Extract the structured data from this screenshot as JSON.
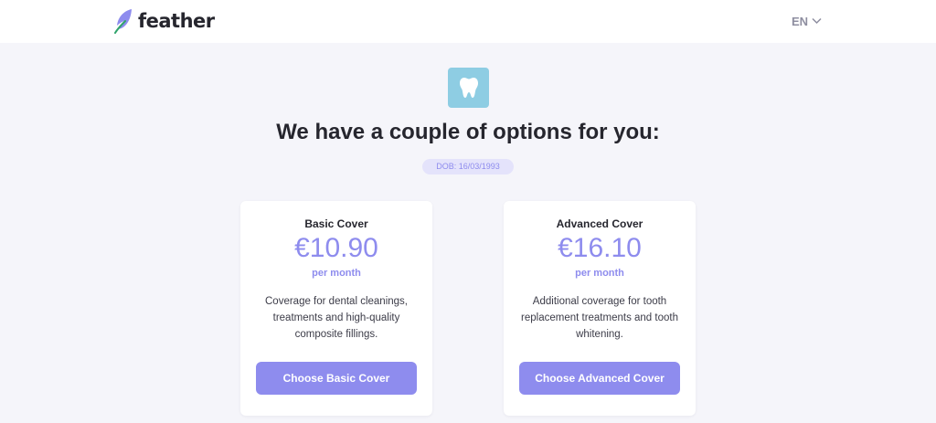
{
  "header": {
    "logo_text": "feather",
    "language": "EN"
  },
  "hero": {
    "icon": "tooth-icon",
    "headline": "We have a couple of options for you:",
    "dob_badge": "DOB: 16/03/1993"
  },
  "plans": [
    {
      "title": "Basic Cover",
      "price": "€10.90",
      "period": "per month",
      "description": "Coverage for dental cleanings, treatments and high-quality composite fillings.",
      "button_label": "Choose Basic Cover"
    },
    {
      "title": "Advanced Cover",
      "price": "€16.10",
      "period": "per month",
      "description": "Additional coverage for tooth replacement treatments and tooth whitening.",
      "button_label": "Choose Advanced Cover"
    }
  ],
  "colors": {
    "accent": "#8e8cee",
    "tooth_badge": "#8ecde3",
    "page_background": "#f5f5fa",
    "text": "#26262e"
  }
}
